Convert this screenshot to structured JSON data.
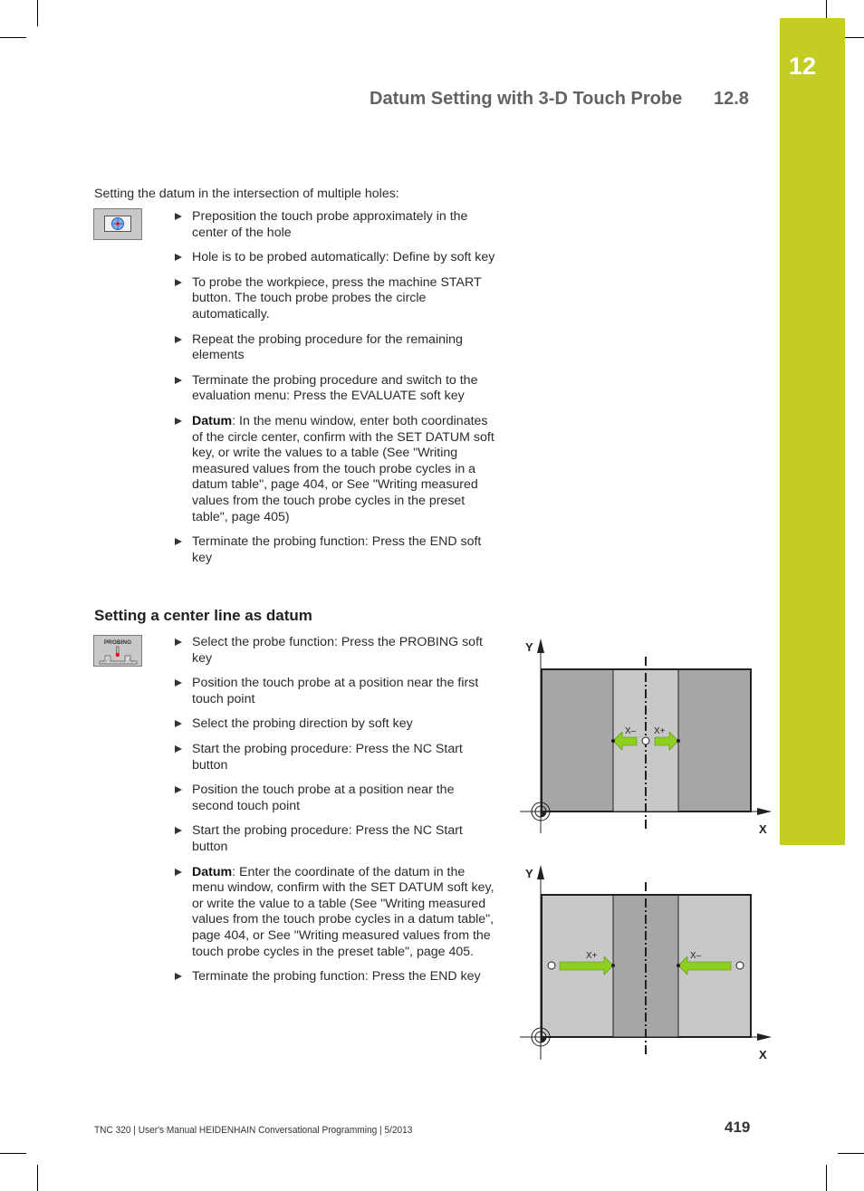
{
  "header": {
    "chapter_number": "12",
    "section_title": "Datum Setting with 3-D Touch Probe",
    "section_number": "12.8",
    "tab_color": "#c3cd22"
  },
  "section1": {
    "intro": "Setting the datum in the intersection of multiple holes:",
    "softkey_icon": "circle-probe-softkey-icon",
    "steps": [
      {
        "bold": "",
        "text": "Preposition the touch probe approximately in the center of the hole"
      },
      {
        "bold": "",
        "text": "Hole is to be probed automatically: Define by soft key"
      },
      {
        "bold": "",
        "text": "To probe the workpiece, press the machine START button. The touch probe probes the circle automatically."
      },
      {
        "bold": "",
        "text": "Repeat the probing procedure for the remaining elements"
      },
      {
        "bold": "",
        "text": "Terminate the probing procedure and switch to the evaluation menu: Press the EVALUATE soft key"
      },
      {
        "bold": "Datum",
        "text": ": In the menu window, enter both coordinates of the circle center, confirm with the SET DATUM soft key, or write the values to a table (See \"Writing measured values from the touch probe cycles in a datum table\", page 404, or See \"Writing measured values from the touch probe cycles in the preset table\", page 405)"
      },
      {
        "bold": "",
        "text": "Terminate the probing function: Press the END soft key"
      }
    ]
  },
  "section2": {
    "heading": "Setting a center line as datum",
    "softkey_label": "PROBING",
    "steps": [
      {
        "bold": "",
        "text": "Select the probe function: Press the PROBING soft key"
      },
      {
        "bold": "",
        "text": "Position the touch probe at a position near the first touch point"
      },
      {
        "bold": "",
        "text": "Select the probing direction by soft key"
      },
      {
        "bold": "",
        "text": "Start the probing procedure: Press the NC Start button"
      },
      {
        "bold": "",
        "text": "Position the touch probe at a position near the second touch point"
      },
      {
        "bold": "",
        "text": "Start the probing procedure: Press the NC Start button"
      },
      {
        "bold": "Datum",
        "text": ": Enter the coordinate of the datum in the menu window, confirm with the SET DATUM soft key, or write the value to a table (See \"Writing measured values from the touch probe cycles in a datum table\", page 404, or See \"Writing measured values from the touch probe cycles in the preset table\", page 405."
      },
      {
        "bold": "",
        "text": "Terminate the probing function: Press the END key"
      }
    ]
  },
  "diagrams": [
    {
      "axis_x": "X",
      "axis_y": "Y",
      "arrow_left_label": "X–",
      "arrow_right_label": "X+",
      "variant": "outward-probing"
    },
    {
      "axis_x": "X",
      "axis_y": "Y",
      "arrow_left_label": "X+",
      "arrow_right_label": "X–",
      "variant": "inward-probing"
    }
  ],
  "colors": {
    "arrow_green": "#8ccf1f",
    "dark_gray": "#a7a6a7",
    "light_gray": "#c8c8c8"
  },
  "footer": {
    "text": "TNC 320 | User's Manual HEIDENHAIN Conversational Programming | 5/2013",
    "page_number": "419"
  }
}
